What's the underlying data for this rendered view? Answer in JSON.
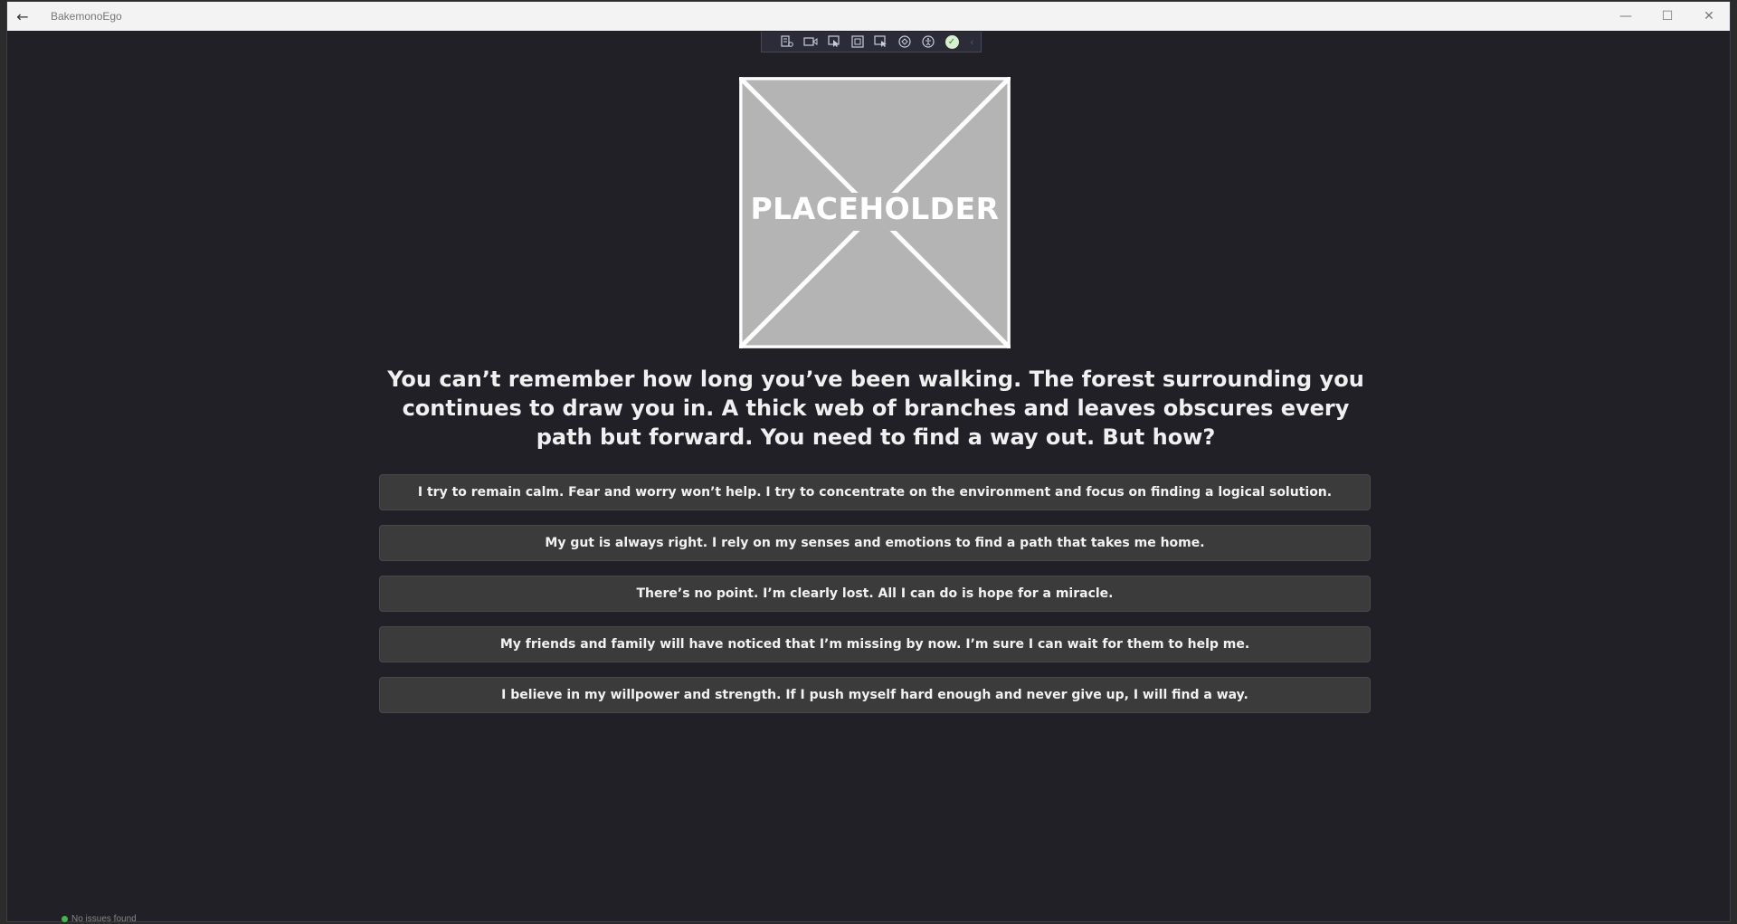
{
  "window": {
    "title": "BakemonoEgo",
    "back_icon": "←",
    "minimize_icon": "—",
    "maximize_icon": "☐",
    "close_icon": "✕"
  },
  "debug_toolbar": {
    "icons": [
      "live-visual-tree-icon",
      "record-icon",
      "select-element-icon",
      "display-layout-adorners-icon",
      "track-focus-icon",
      "binding-failures-icon",
      "accessibility-icon",
      "check-icon"
    ],
    "collapse_icon": "‹"
  },
  "image": {
    "label": "PLACEHOLDER"
  },
  "question": "You can’t remember how long you’ve been walking. The forest surrounding you continues to draw you in. A thick web of branches and leaves obscures every path but forward. You need to find a way out. But how?",
  "choices": [
    {
      "label": "I try to remain calm. Fear and worry won’t help. I try to concentrate on the environment and focus on finding a logical solution."
    },
    {
      "label": "My gut is always right. I rely on my senses and emotions to find a path that takes me home."
    },
    {
      "label": "There’s no point. I’m clearly lost. All I can do is hope for a miracle."
    },
    {
      "label": "My friends and family will have noticed that I’m missing by now. I’m sure I can wait for them to help me."
    },
    {
      "label": "I believe in my willpower and strength. If I push myself hard enough and never give up, I will find a way."
    }
  ],
  "status_bar": {
    "text": "No issues found"
  },
  "colors": {
    "background": "#202026",
    "button": "#3b3b3b",
    "placeholder": "#b4b4b4"
  }
}
